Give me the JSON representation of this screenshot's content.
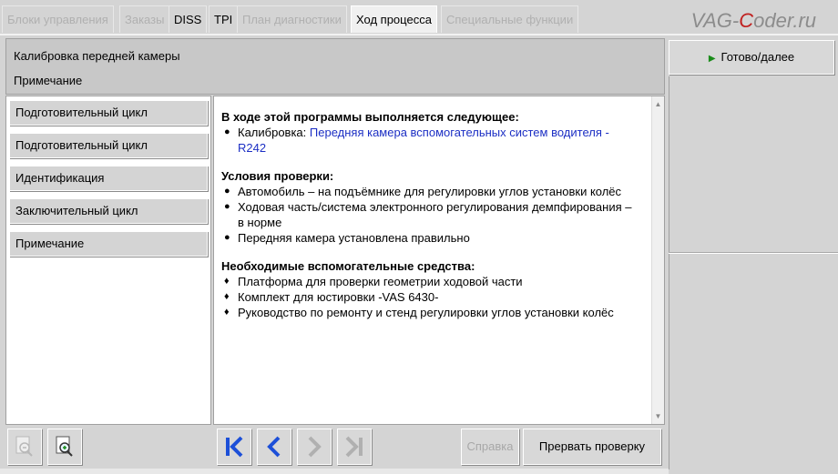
{
  "tabs": [
    {
      "label": "Блоки управления"
    },
    {
      "label": "Заказы"
    },
    {
      "label": "DISS"
    },
    {
      "label": "TPI"
    },
    {
      "label": "План диагностики"
    },
    {
      "label": "Ход процесса"
    },
    {
      "label": "Специальные функции"
    }
  ],
  "watermark": {
    "part1": "VAG-",
    "part2": "C",
    "part3": "oder.ru"
  },
  "header": {
    "title": "Калибровка передней камеры",
    "subtitle": "Примечание"
  },
  "steps": [
    {
      "label": "Подготовительный цикл"
    },
    {
      "label": "Подготовительный цикл"
    },
    {
      "label": "Идентификация"
    },
    {
      "label": "Заключительный цикл"
    },
    {
      "label": "Примечание"
    }
  ],
  "content": {
    "intro_heading": "В ходе этой программы выполняется следующее:",
    "intro_item_prefix": "Калибровка: ",
    "intro_item_link": "Передняя камера вспомогательных систем водителя - R242",
    "conditions_heading": "Условия проверки:",
    "conditions": [
      "Автомобиль – на подъёмнике для регулировки углов установки колёс",
      "Ходовая часть/система электронного регулирования демпфирования – в норме",
      "Передняя камера установлена правильно"
    ],
    "tools_heading": "Необходимые вспомогательные средства:",
    "tools": [
      "Платформа для проверки геометрии ходовой части",
      "Комплект для юстировки -VAS 6430-",
      "Руководство по ремонту и стенд регулировки углов установки колёс"
    ]
  },
  "right": {
    "done_label": "Готово/далее"
  },
  "bottom": {
    "help_label": "Справка",
    "abort_label": "Прервать проверку"
  },
  "colors": {
    "accent_blue": "#1c4fd8",
    "link": "#1c2fc4",
    "play_green": "#1a8c1a",
    "brand_red": "#c0201f"
  }
}
